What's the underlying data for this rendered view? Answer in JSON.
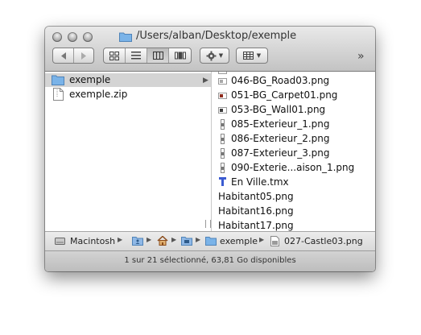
{
  "window": {
    "title": "/Users/alban/Desktop/exemple"
  },
  "toolbar": {
    "back_icon": "back-arrow-icon",
    "forward_icon": "forward-arrow-icon",
    "view_modes": [
      "icon-view",
      "list-view",
      "column-view",
      "cover-flow-view"
    ],
    "active_view": "column-view",
    "action_icon": "gear-icon",
    "arrange_icon": "arrange-grid-icon",
    "overflow_label": "»"
  },
  "sidebar_column": {
    "items": [
      {
        "label": "exemple",
        "icon": "folder-icon",
        "selected": true,
        "has_children": true,
        "disclosure": "▶"
      },
      {
        "label": "exemple.zip",
        "icon": "document-icon",
        "selected": false
      }
    ]
  },
  "files_column": {
    "items": [
      {
        "label": "046-BG_Road03.png",
        "icon": "image-thumb-icon",
        "thumb_color": "#a9a9a9"
      },
      {
        "label": "051-BG_Carpet01.png",
        "icon": "image-thumb-icon",
        "thumb_color": "#8e2a1c"
      },
      {
        "label": "053-BG_Wall01.png",
        "icon": "image-thumb-icon",
        "thumb_color": "#3e3e3e"
      },
      {
        "label": "085-Exterieur_1.png",
        "icon": "tall-image-thumb-icon"
      },
      {
        "label": "086-Exterieur_2.png",
        "icon": "tall-image-thumb-icon"
      },
      {
        "label": "087-Exterieur_3.png",
        "icon": "tall-image-thumb-icon"
      },
      {
        "label": "090-Exterie...aison_1.png",
        "icon": "tall-image-thumb-icon"
      },
      {
        "label": "En Ville.tmx",
        "icon": "tmx-file-icon",
        "icon_color": "#3b5bd1"
      },
      {
        "label": "Habitant05.png",
        "icon": "image-thumb-icon"
      },
      {
        "label": "Habitant16.png",
        "icon": "image-thumb-icon"
      },
      {
        "label": "Habitant17.png",
        "icon": "image-thumb-icon"
      }
    ]
  },
  "pathbar": {
    "items": [
      {
        "label": "Macintosh",
        "icon": "hard-drive-icon"
      },
      {
        "label": "",
        "icon": "users-folder-icon"
      },
      {
        "label": "",
        "icon": "home-icon"
      },
      {
        "label": "",
        "icon": "desktop-folder-icon"
      },
      {
        "label": "exemple",
        "icon": "folder-icon"
      },
      {
        "label": "027-Castle03.png",
        "icon": "image-file-icon"
      }
    ],
    "separator": "▶"
  },
  "status": {
    "text": "1 sur 21 sélectionné, 63,81 Go disponibles"
  },
  "colors": {
    "folder_blue": "#7ab3e8",
    "selection_gray": "#d4d4d4"
  }
}
